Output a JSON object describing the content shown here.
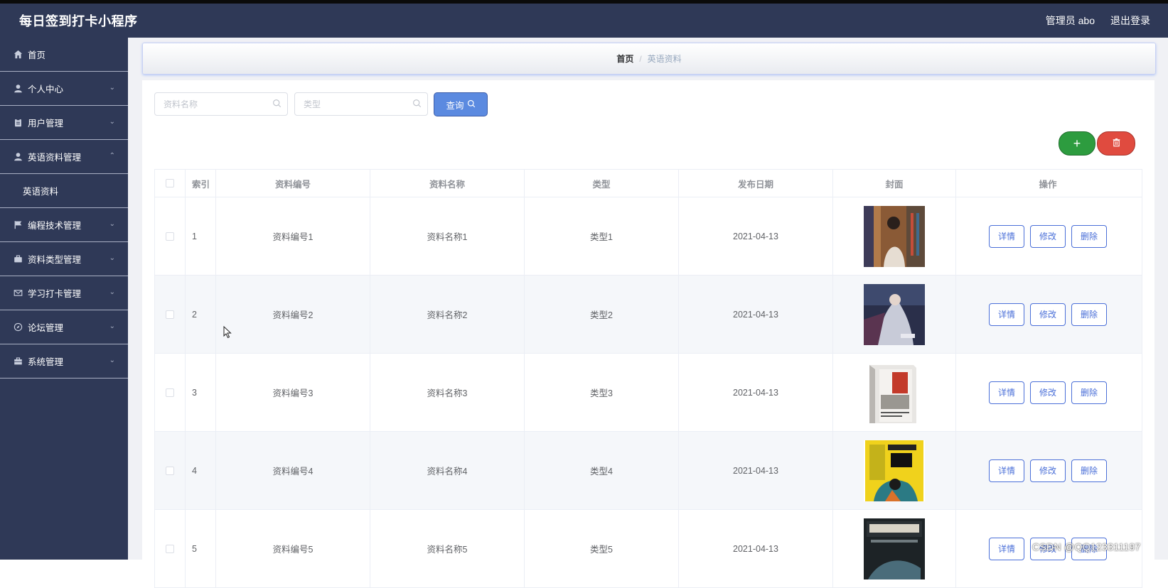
{
  "header": {
    "app_title": "每日签到打卡小程序",
    "admin_label": "管理员 abo",
    "logout_label": "退出登录"
  },
  "sidebar": {
    "items": [
      {
        "label": "首页",
        "icon": "home-icon"
      },
      {
        "label": "个人中心",
        "icon": "user-icon"
      },
      {
        "label": "用户管理",
        "icon": "clipboard-icon"
      },
      {
        "label": "英语资料管理",
        "icon": "user-icon",
        "expanded": true
      },
      {
        "label": "英语资料",
        "submenu": true
      },
      {
        "label": "编程技术管理",
        "icon": "flag-icon"
      },
      {
        "label": "资料类型管理",
        "icon": "briefcase-icon"
      },
      {
        "label": "学习打卡管理",
        "icon": "mail-icon"
      },
      {
        "label": "论坛管理",
        "icon": "compass-icon"
      },
      {
        "label": "系统管理",
        "icon": "toolbox-icon"
      }
    ]
  },
  "breadcrumb": {
    "home": "首页",
    "sep": "/",
    "current": "英语资料"
  },
  "search": {
    "name_placeholder": "资料名称",
    "type_placeholder": "类型",
    "query_label": "查询"
  },
  "table": {
    "headers": [
      "索引",
      "资料编号",
      "资料名称",
      "类型",
      "发布日期",
      "封面",
      "操作"
    ],
    "rows": [
      {
        "idx": "1",
        "code": "资料编号1",
        "name": "资料名称1",
        "type": "类型1",
        "date": "2021-04-13"
      },
      {
        "idx": "2",
        "code": "资料编号2",
        "name": "资料名称2",
        "type": "类型2",
        "date": "2021-04-13"
      },
      {
        "idx": "3",
        "code": "资料编号3",
        "name": "资料名称3",
        "type": "类型3",
        "date": "2021-04-13"
      },
      {
        "idx": "4",
        "code": "资料编号4",
        "name": "资料名称4",
        "type": "类型4",
        "date": "2021-04-13"
      },
      {
        "idx": "5",
        "code": "资料编号5",
        "name": "资料名称5",
        "type": "类型5",
        "date": "2021-04-13"
      }
    ],
    "ops": {
      "detail": "详情",
      "edit": "修改",
      "delete": "删除"
    }
  },
  "watermark": "CSDN @QQ123311197",
  "colors": {
    "sidebar_bg": "#2f3957",
    "primary": "#4a6fd8",
    "add_green": "#2d9c3f",
    "delete_red": "#e04b3f"
  }
}
